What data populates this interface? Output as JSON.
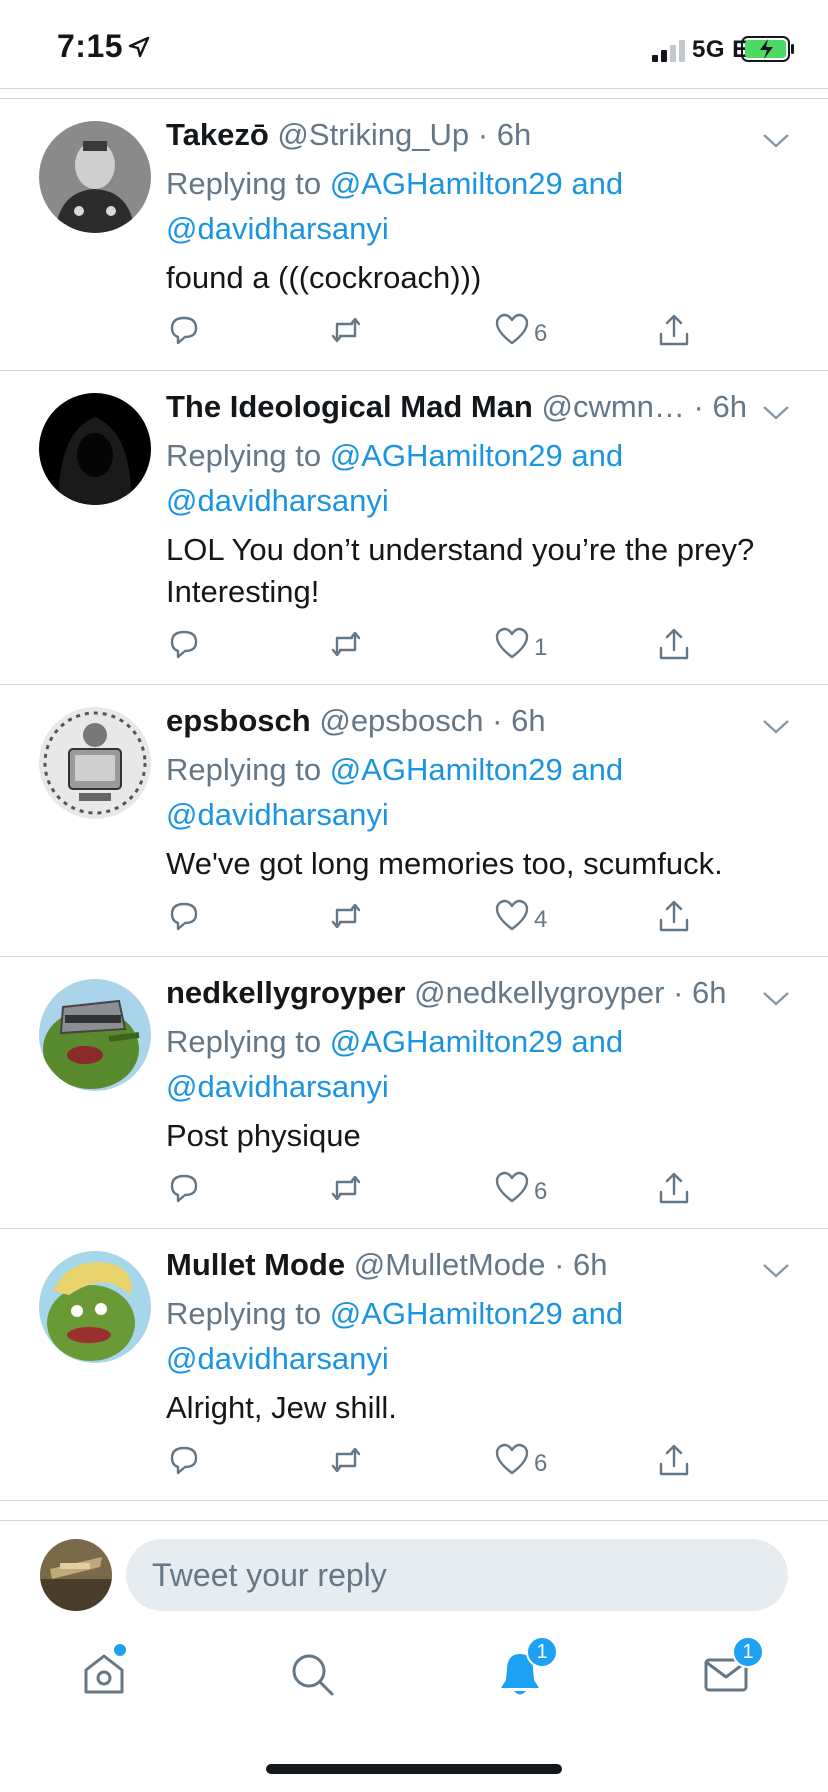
{
  "status_bar": {
    "time": "7:15",
    "network": "5G E"
  },
  "tweets": [
    {
      "name": "Takezō",
      "handle": "@Striking_Up",
      "time": "6h",
      "reply_prefix": "Replying to",
      "mention1": "@AGHamilton29",
      "reply_and": "and",
      "mention2": "@davidharsanyi",
      "text": "found a (((cockroach)))",
      "likes": "6"
    },
    {
      "name": "The Ideological Mad Man",
      "handle": "@cwmn…",
      "time": "6h",
      "reply_prefix": "Replying to",
      "mention1": "@AGHamilton29",
      "reply_and": "and",
      "mention2": "@davidharsanyi",
      "text": "LOL You don’t understand you’re the prey? Interesting!",
      "likes": "1"
    },
    {
      "name": "epsbosch",
      "handle": "@epsbosch",
      "time": "6h",
      "reply_prefix": "Replying to",
      "mention1": "@AGHamilton29",
      "reply_and": "and",
      "mention2": "@davidharsanyi",
      "text": "We've got long memories too, scumfuck.",
      "likes": "4"
    },
    {
      "name": "nedkellygroyper",
      "handle": "@nedkellygroyper",
      "time": "6h",
      "reply_prefix": "Replying to",
      "mention1": "@AGHamilton29",
      "reply_and": "and",
      "mention2": "@davidharsanyi",
      "text": "Post physique",
      "likes": "6"
    },
    {
      "name": "Mullet Mode",
      "handle": "@MulletMode",
      "time": "6h",
      "reply_prefix": "Replying to",
      "mention1": "@AGHamilton29",
      "reply_and": "and",
      "mention2": "@davidharsanyi",
      "text": "Alright, Jew shill.",
      "likes": "6"
    }
  ],
  "reply_box": {
    "placeholder": "Tweet your reply"
  },
  "tab_bar": {
    "notifications_badge": "1",
    "messages_badge": "1"
  },
  "colors": {
    "accent": "#1da1f2",
    "mention": "#1b95e0",
    "secondary_text": "#657786",
    "divider": "#cfd6db"
  }
}
